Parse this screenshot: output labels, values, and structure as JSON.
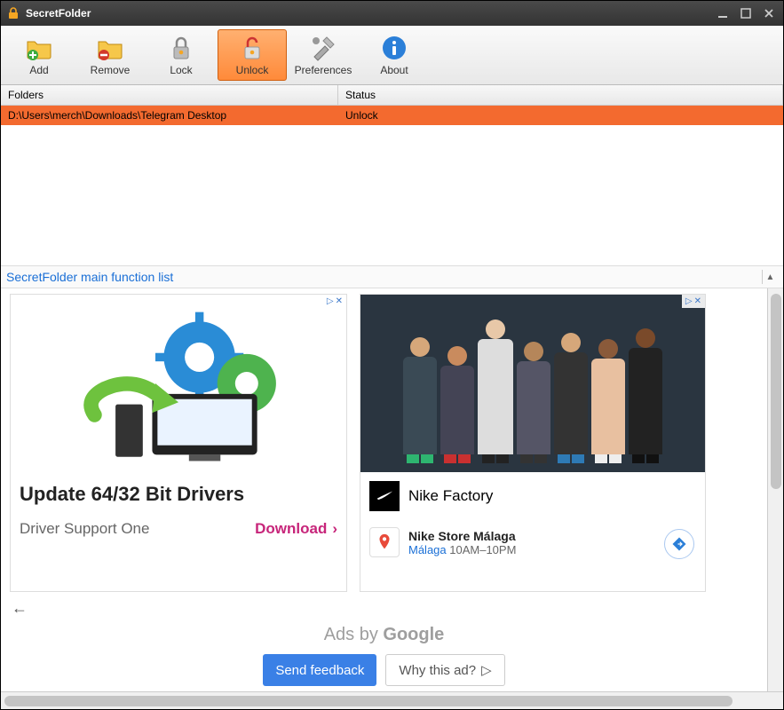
{
  "window": {
    "title": "SecretFolder"
  },
  "toolbar": {
    "add": "Add",
    "remove": "Remove",
    "lock": "Lock",
    "unlock": "Unlock",
    "preferences": "Preferences",
    "about": "About"
  },
  "table": {
    "col_folders": "Folders",
    "col_status": "Status",
    "rows": [
      {
        "folder": "D:\\Users\\merch\\Downloads\\Telegram Desktop",
        "status": "Unlock"
      }
    ]
  },
  "link": {
    "text": "SecretFolder main function list"
  },
  "ad_left": {
    "title": "Update 64/32 Bit Drivers",
    "subtitle": "Driver Support One",
    "cta": "Download"
  },
  "ad_right": {
    "brand": "Nike Factory",
    "store_name": "Nike Store Málaga",
    "location": "Málaga",
    "hours": "10AM–10PM"
  },
  "ads_footer": {
    "ads_by_pre": "Ads by ",
    "ads_by_brand": "Google",
    "send_feedback": "Send feedback",
    "why_this_ad": "Why this ad?"
  }
}
